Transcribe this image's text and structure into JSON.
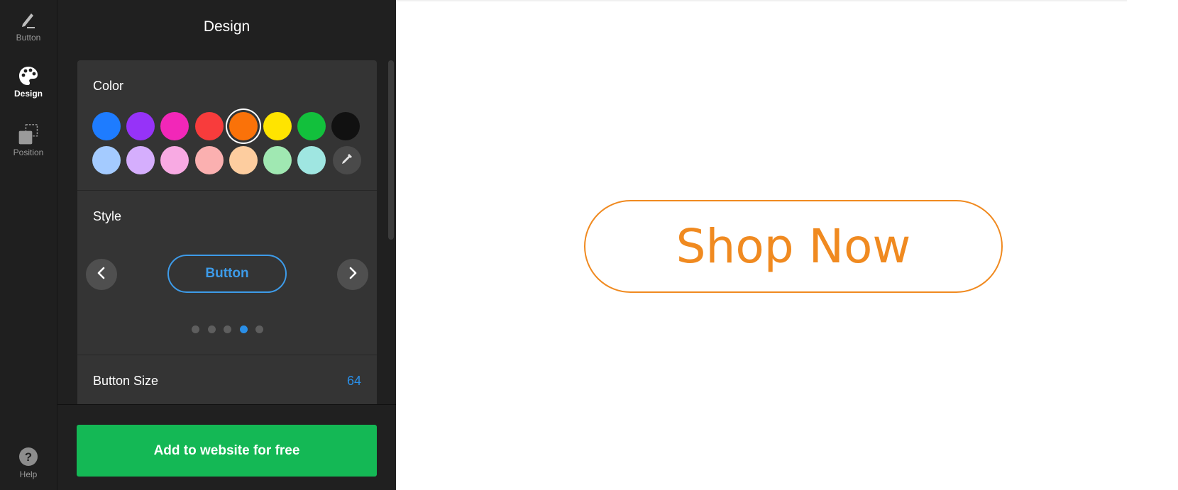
{
  "rail": {
    "items": [
      {
        "label": "Button",
        "icon": "pencil-icon"
      },
      {
        "label": "Design",
        "icon": "palette-icon"
      },
      {
        "label": "Position",
        "icon": "position-icon"
      }
    ],
    "help": {
      "label": "Help",
      "icon": "help-icon",
      "glyph": "?"
    }
  },
  "panel": {
    "title": "Design",
    "color": {
      "label": "Color",
      "row1": [
        "#1e7cff",
        "#9633f8",
        "#f227b8",
        "#f83c3c",
        "#fa7209",
        "#ffe400",
        "#12c03c",
        "#111111"
      ],
      "row2": [
        "#a4cbff",
        "#d5aefd",
        "#f8aae3",
        "#fbb0b0",
        "#fdcd9f",
        "#a0e8b2",
        "#9fe6e1"
      ],
      "selected_color": "#fa7209",
      "eyedropper_icon": "eyedropper-icon"
    },
    "style": {
      "label": "Style",
      "preview_label": "Button",
      "preview_color": "#3d9be9",
      "prev_icon": "chevron-left-icon",
      "next_icon": "chevron-right-icon",
      "page_count": 5,
      "active_page": 4
    },
    "size": {
      "label": "Button Size",
      "value": "64"
    },
    "cta_label": "Add to website for free",
    "cta_color": "#14b855"
  },
  "preview": {
    "label": "Shop Now",
    "color": "#f08a20"
  }
}
